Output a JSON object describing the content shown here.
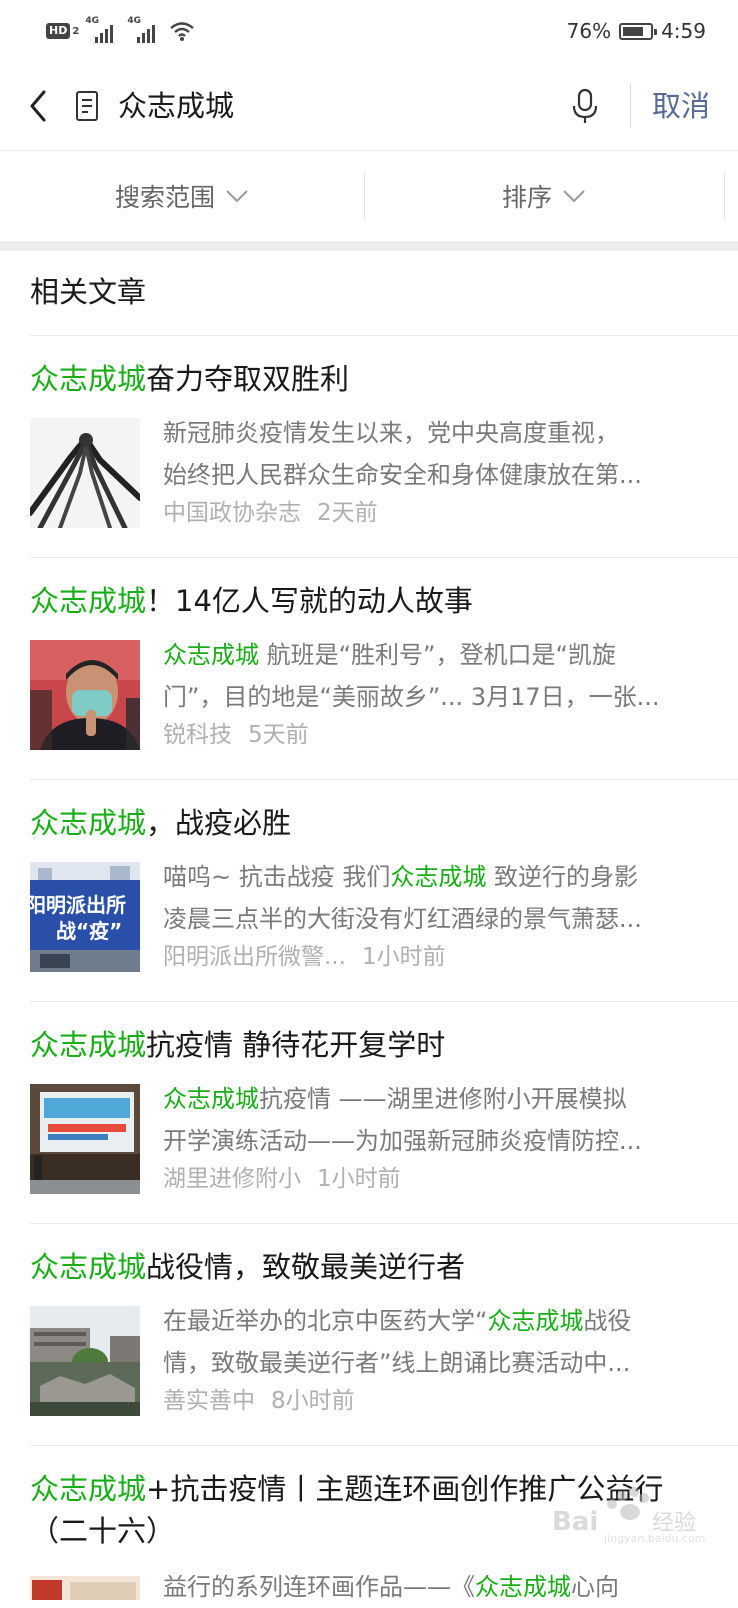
{
  "status_bar": {
    "hd": "HD",
    "hd_sub": "2",
    "signal1_label": "4G",
    "signal2_label": "4G",
    "battery_text": "76%",
    "battery_level": 0.76,
    "time": "4:59"
  },
  "search": {
    "query": "众志成城",
    "cancel_label": "取消"
  },
  "filters": {
    "scope_label": "搜索范围",
    "sort_label": "排序"
  },
  "section_title": "相关文章",
  "results": [
    {
      "title_hl": "众志成城",
      "title_rest": "奋力夺取双胜利",
      "title_rest2": "",
      "snippet_hl": "",
      "snippet_line1": "新冠肺炎疫情发生以来，党中央高度重视，",
      "snippet_line2": "始终把人民群众生命安全和身体健康放在第...",
      "source": "中国政协杂志",
      "time": "2天前"
    },
    {
      "title_hl": "众志成城",
      "title_rest": "！14亿人写就的动人故事",
      "title_rest2": "",
      "snippet_hl": "众志成城",
      "snippet_line1": " 航班是“胜利号”，登机口是“凯旋",
      "snippet_line2": "门”，目的地是“美丽故乡”... 3月17日，一张...",
      "source": "锐科技",
      "time": "5天前"
    },
    {
      "title_hl": "众志成城",
      "title_rest": "，战疫必胜",
      "title_rest2": "",
      "snippet_pre": "喵呜~ 抗击战疫 我们",
      "snippet_hl": "众志成城",
      "snippet_line1": " 致逆行的身影",
      "snippet_line2": "凌晨三点半的大街没有灯红酒绿的景气萧瑟...",
      "source": "阳明派出所微警...",
      "time": "1小时前",
      "thumb_text1": "阳明派出所",
      "thumb_text2": "战“疫”"
    },
    {
      "title_hl": "众志成城",
      "title_rest": "抗疫情 静待花开复学时",
      "title_rest2": "",
      "snippet_hl": "众志成城",
      "snippet_line1": "抗疫情 ——湖里进修附小开展模拟",
      "snippet_line2": "开学演练活动——为加强新冠肺炎疫情防控...",
      "source": "湖里进修附小",
      "time": "1小时前"
    },
    {
      "title_hl": "众志成城",
      "title_rest": "战役情，致敬最美逆行者",
      "title_rest2": "",
      "snippet_pre": "在最近举办的北京中医药大学“",
      "snippet_hl": "众志成城",
      "snippet_line1": "战役",
      "snippet_line2": "情，致敬最美逆行者”线上朗诵比赛活动中...",
      "source": "善实善中",
      "time": "8小时前"
    },
    {
      "title_hl": "众志成城",
      "title_rest": "+抗击疫情丨主题连环画创作推广公益行",
      "title_rest2": "（二十六）",
      "snippet_pre": "益行的系列连环画作品——《",
      "snippet_hl": "众志成城",
      "snippet_line1": "心向"
    }
  ],
  "colors": {
    "highlight": "#1aad19",
    "cancel": "#576b95",
    "snippet": "#7a7a7a",
    "meta": "#b0b0b0"
  }
}
